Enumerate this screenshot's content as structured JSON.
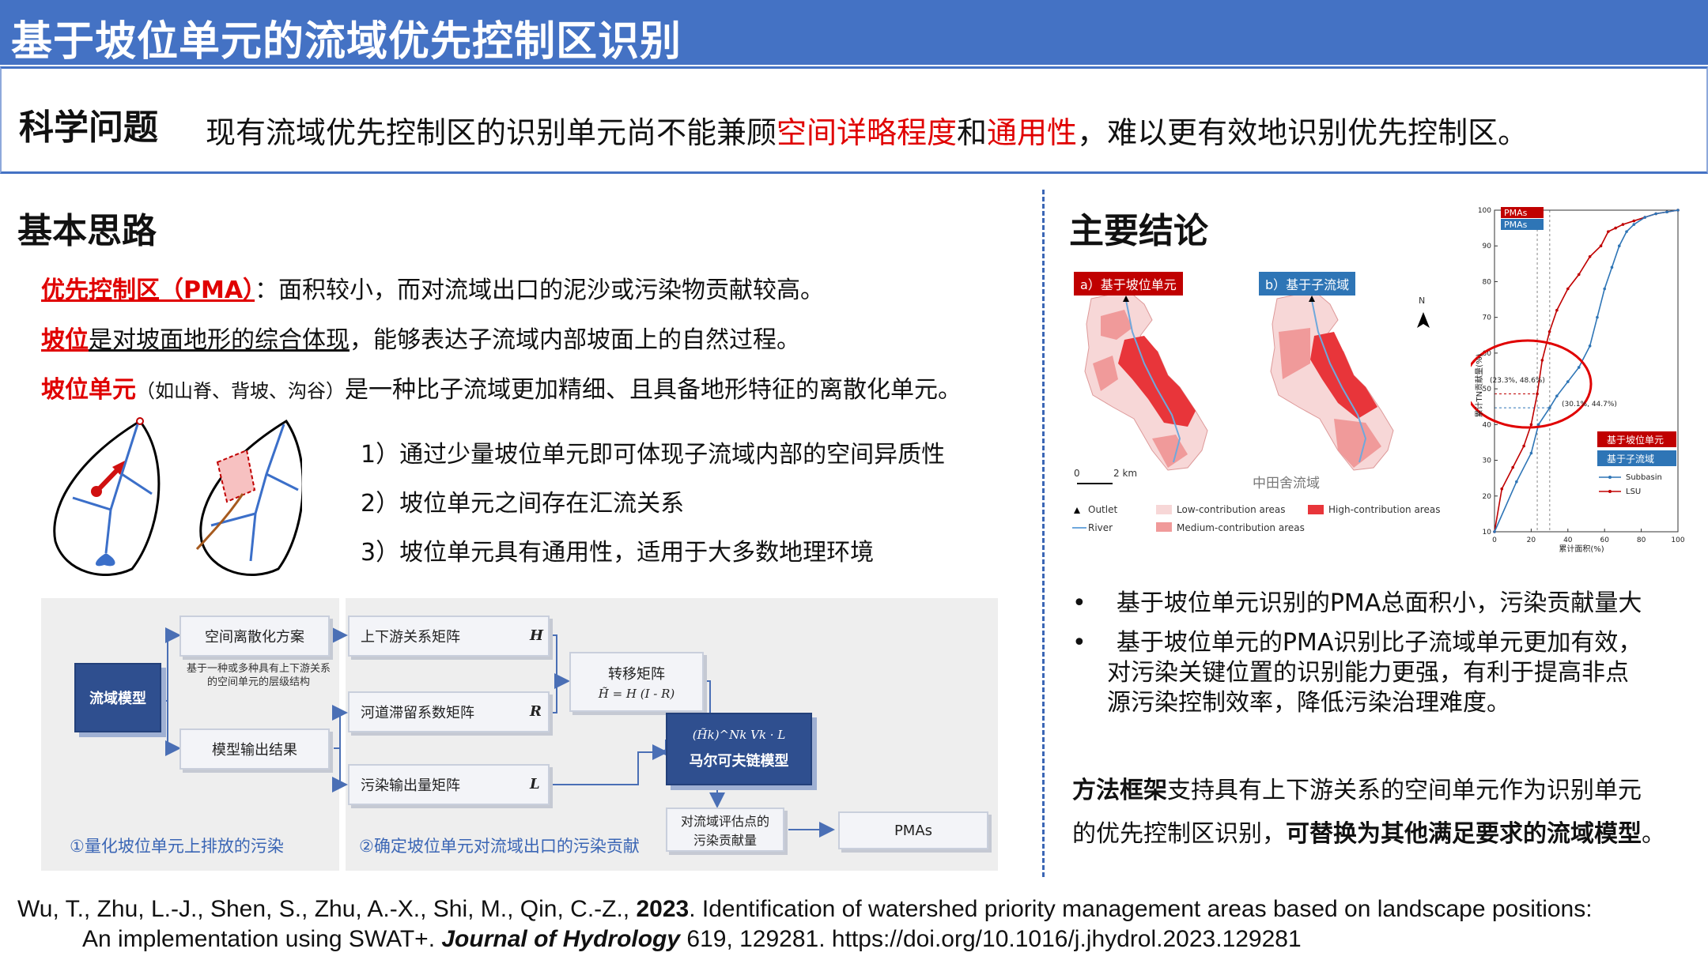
{
  "title": "基于坡位单元的流域优先控制区识别",
  "question": {
    "label": "科学问题",
    "text_a": "现有流域优先控制区的识别单元尚不能兼顾",
    "highlight1": "空间详略程度",
    "text_b": "和",
    "highlight2": "通用性",
    "text_c": "，难以更有效地识别优先控制区。"
  },
  "left": {
    "section_title": "基本思路",
    "line1_term": "优先控制区（PMA）",
    "line1_rest": "：面积较小，而对流域出口的泥沙或污染物贡献较高。",
    "line2_term": "坡位",
    "line2_u": "是对坡面地形的综合体现",
    "line2_rest": "，能够表达子流域内部坡面上的自然过程。",
    "line3_term": "坡位单元",
    "line3_paren": "（如山脊、背坡、沟谷）",
    "line3_rest": "是一种比子流域更加精细、且具备地形特征的离散化单元。",
    "points": [
      "1）通过少量坡位单元即可体现子流域内部的空间异质性",
      "2）坡位单元之间存在汇流关系",
      "3）坡位单元具有通用性，适用于大多数地理环境"
    ]
  },
  "flow": {
    "watershed_model": "流域模型",
    "discretization": "空间离散化方案",
    "discretization_note_1": "基于一种或多种具有上下游关系",
    "discretization_note_2": "的空间单元的层级结构",
    "model_output": "模型输出结果",
    "matrix_updown": "上下游关系矩阵",
    "matrix_retention": "河道滞留系数矩阵",
    "matrix_pollution": "污染输出量矩阵",
    "sym_h": "H",
    "sym_r": "R",
    "sym_l": "L",
    "transfer": "转移矩阵",
    "transfer_formula": "H̃ = H (I - R)",
    "markov_formula": "(H̃k)^Nk Vk · L",
    "markov": "马尔可夫链模型",
    "contribution_1": "对流域评估点的",
    "contribution_2": "污染贡献量",
    "pmas": "PMAs",
    "caption1": "①量化坡位单元上排放的污染",
    "caption2": "②确定坡位单元对流域出口的污染贡献"
  },
  "right": {
    "section_title": "主要结论",
    "map": {
      "tag_a": "a）基于坡位单元",
      "tag_b": "b）基于子流域",
      "north": "N",
      "scale_0": "0",
      "scale_2": "2 km",
      "basin": "中田舍流域",
      "legend_outlet": "Outlet",
      "legend_river": "River",
      "legend_low": "Low-contribution areas",
      "legend_medium": "Medium-contribution areas",
      "legend_high": "High-contribution areas",
      "colors": {
        "low": "#f7d7d7",
        "medium": "#f09a9a",
        "high": "#e8353a"
      }
    },
    "bullets": [
      [
        "基于坡位单元识别的PMA总面积小，污染贡献量大"
      ],
      [
        "基于坡位单元的PMA识别比子流域单元更加有效，",
        "对污染关键位置的识别能力更强，有利于提高非点",
        "源污染控制效率，降低污染治理难度。"
      ]
    ],
    "conclusion": {
      "b1": "方法框架",
      "t1": "支持具有上下游关系的空间单元作为识别单元",
      "t2": "的优先控制区识别，",
      "b2": "可替换为其他满足要求的流域模型",
      "t3": "。"
    }
  },
  "chart_data": {
    "type": "line",
    "xlabel": "累计面积(%)",
    "ylabel": "累计TN贡献量(%)",
    "xlim": [
      0,
      100
    ],
    "ylim": [
      10,
      100
    ],
    "xticks": [
      0,
      20,
      40,
      60,
      80,
      100
    ],
    "yticks": [
      10,
      20,
      30,
      40,
      50,
      60,
      70,
      80,
      90,
      100
    ],
    "legend_top": [
      "PMAs",
      "PMAs"
    ],
    "legend_box": [
      "基于坡位单元",
      "基于子流域"
    ],
    "annotations": [
      "(23.3%, 48.6%)",
      "(30.1%, 44.7%)"
    ],
    "series": [
      {
        "name": "LSU",
        "color": "#c00000",
        "x": [
          0,
          4,
          10,
          16,
          20,
          23.3,
          26,
          30,
          34,
          40,
          46,
          52,
          58,
          62,
          66,
          70,
          76,
          82,
          88,
          94,
          100
        ],
        "y": [
          10,
          22,
          28,
          34,
          40,
          48.6,
          58,
          66,
          72,
          78,
          82,
          87,
          90,
          94,
          95,
          96,
          97,
          98,
          99,
          99.5,
          100
        ]
      },
      {
        "name": "Subbasin",
        "color": "#2e75b6",
        "x": [
          0,
          12,
          20,
          24,
          30.1,
          34,
          40,
          46,
          52,
          56,
          60,
          64,
          68,
          72,
          76,
          82,
          88,
          94,
          100
        ],
        "y": [
          10,
          24,
          32,
          40,
          44.7,
          48,
          52,
          56,
          62,
          70,
          78,
          84,
          90,
          94,
          96,
          98,
          99,
          99.5,
          100
        ]
      }
    ]
  },
  "citation": {
    "authors": "Wu, T., Zhu, L.-J., Shen, S., Zhu, A.-X., Shi, M., Qin, C.-Z., ",
    "year": "2023",
    "title_part": ". Identification of watershed priority management areas based on landscape positions:",
    "line2": "An implementation using SWAT+. ",
    "journal": "Journal of Hydrology",
    "rest": " 619, 129281. https://doi.org/10.1016/j.jhydrol.2023.129281"
  }
}
